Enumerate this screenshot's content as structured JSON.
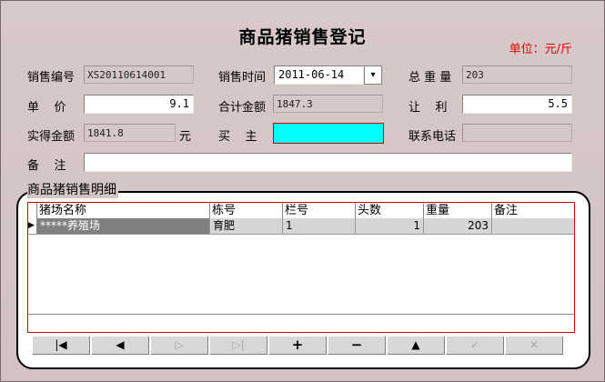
{
  "title": "商品猪销售登记",
  "unit": "单位：元/斤",
  "form": {
    "sale_no_label": "销售编号",
    "sale_no": "XS20110614001",
    "sale_time_label": "销售时间",
    "sale_time": "2011-06-14",
    "total_weight_label": "总 重 量",
    "total_weight": "203",
    "unit_price_label": "单    价",
    "unit_price": "9.1",
    "total_amount_label": "合计金额",
    "total_amount": "1847.3",
    "discount_label": "让    利",
    "discount": "5.5",
    "actual_amount_label": "实得金额",
    "actual_amount": "1841.8",
    "yuan": "元",
    "buyer_label": "买    主",
    "buyer": "",
    "phone_label": "联系电话",
    "phone": "",
    "remark_label": "备    注",
    "remark": ""
  },
  "detail_title": "商品猪销售明细",
  "table": {
    "headers": [
      "猪场名称",
      "栋号",
      "栏号",
      "头数",
      "重量",
      "备注"
    ],
    "rows": [
      {
        "farm": "*****养殖场",
        "building": "育肥",
        "pen": "1",
        "count": "1",
        "weight": "203",
        "remark": ""
      }
    ]
  },
  "nav": {
    "first": "|◀",
    "prev": "◀",
    "next": "▷",
    "last": "▷|",
    "add": "+",
    "delete": "−",
    "up": "▲",
    "save": "✓",
    "cancel": "✕"
  }
}
